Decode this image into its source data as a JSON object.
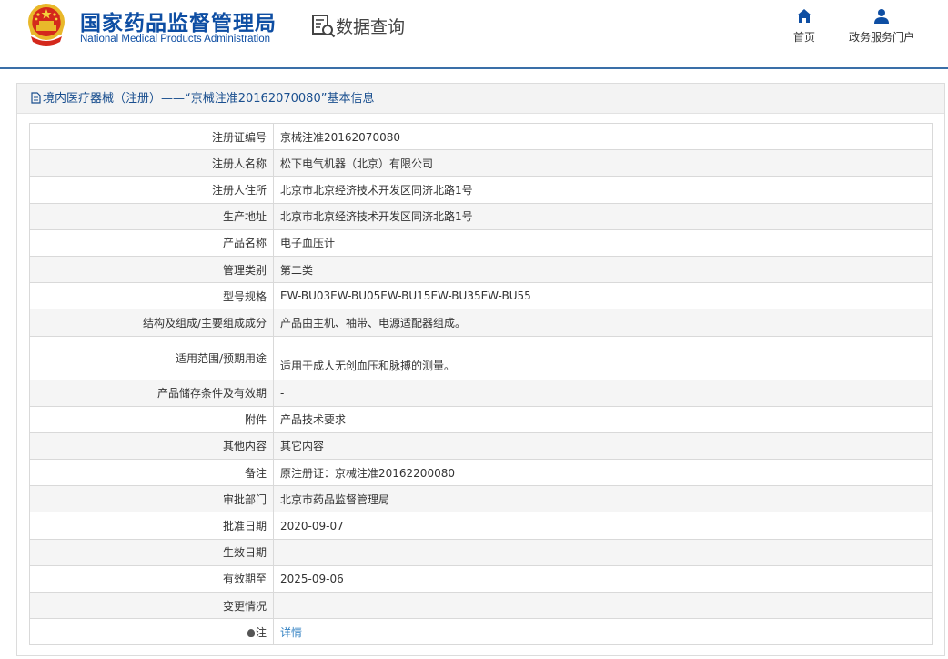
{
  "header": {
    "site_title_cn": "国家药品监督管理局",
    "site_title_en": "National Medical Products Administration",
    "data_query": "数据查询",
    "nav": {
      "home": "首页",
      "portal": "政务服务门户"
    },
    "accent_color": "#0e4ea3",
    "icons": [
      "emblem-icon",
      "search-document-icon",
      "home-icon",
      "user-icon"
    ]
  },
  "panel": {
    "title": "境内医疗器械（注册）——“京械注准20162070080”基本信息"
  },
  "rows": [
    {
      "label": "注册证编号",
      "value": "京械注准20162070080"
    },
    {
      "label": "注册人名称",
      "value": "松下电气机器（北京）有限公司"
    },
    {
      "label": "注册人住所",
      "value": "北京市北京经济技术开发区同济北路1号"
    },
    {
      "label": "生产地址",
      "value": "北京市北京经济技术开发区同济北路1号"
    },
    {
      "label": "产品名称",
      "value": "电子血压计"
    },
    {
      "label": "管理类别",
      "value": "第二类"
    },
    {
      "label": "型号规格",
      "value": "EW-BU03EW-BU05EW-BU15EW-BU35EW-BU55"
    },
    {
      "label": "结构及组成/主要组成成分",
      "value": "产品由主机、袖带、电源适配器组成。"
    },
    {
      "label": "适用范围/预期用途",
      "value": "适用于成人无创血压和脉搏的测量。"
    },
    {
      "label": "产品储存条件及有效期",
      "value": "-"
    },
    {
      "label": "附件",
      "value": "产品技术要求"
    },
    {
      "label": "其他内容",
      "value": "其它内容"
    },
    {
      "label": "备注",
      "value": "原注册证：京械注准20162200080"
    },
    {
      "label": "审批部门",
      "value": "北京市药品监督管理局"
    },
    {
      "label": "批准日期",
      "value": "2020-09-07"
    },
    {
      "label": "生效日期",
      "value": ""
    },
    {
      "label": "有效期至",
      "value": "2025-09-06"
    },
    {
      "label": "变更情况",
      "value": ""
    },
    {
      "label": "注",
      "value": "详情"
    }
  ]
}
